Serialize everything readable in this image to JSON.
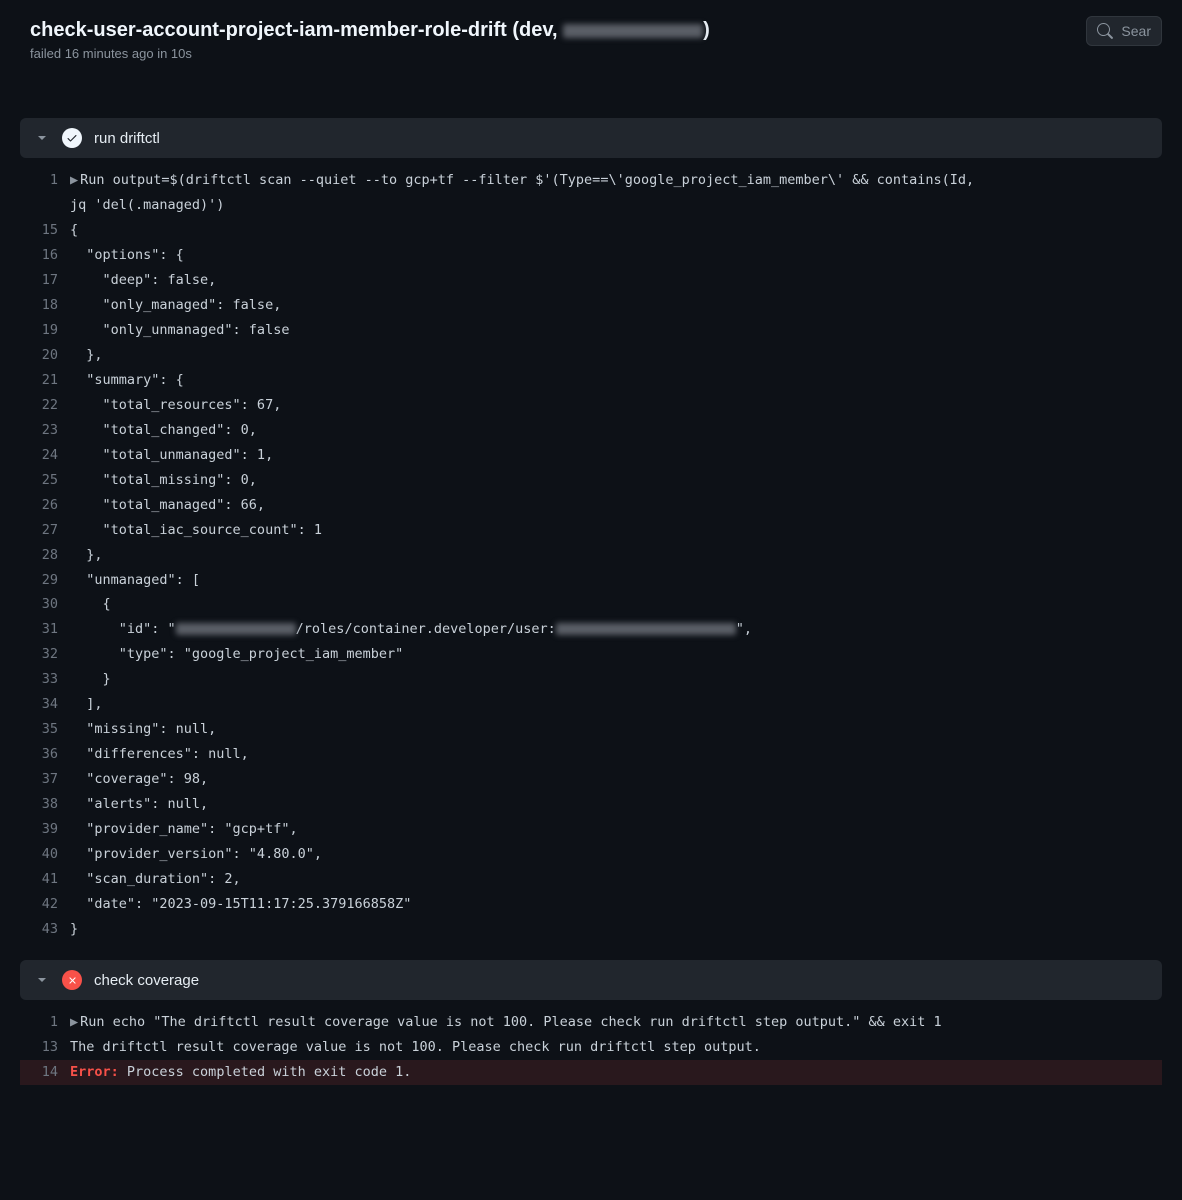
{
  "header": {
    "title_prefix": "check-user-account-project-iam-member-role-drift (dev, ",
    "title_suffix": ")",
    "subtitle": "failed 16 minutes ago in 10s",
    "search_placeholder": "Sear"
  },
  "partial_step": {
    "label": "..."
  },
  "step_run": {
    "title": "run driftctl",
    "lines": [
      {
        "no": "1",
        "tri": true,
        "text": "Run output=$(driftctl scan --quiet --to gcp+tf --filter $'(Type==\\'google_project_iam_member\\' && contains(Id,"
      },
      {
        "no": "",
        "text": "jq 'del(.managed)')"
      },
      {
        "no": "15",
        "text": "{"
      },
      {
        "no": "16",
        "text": "  \"options\": {"
      },
      {
        "no": "17",
        "text": "    \"deep\": false,"
      },
      {
        "no": "18",
        "text": "    \"only_managed\": false,"
      },
      {
        "no": "19",
        "text": "    \"only_unmanaged\": false"
      },
      {
        "no": "20",
        "text": "  },"
      },
      {
        "no": "21",
        "text": "  \"summary\": {"
      },
      {
        "no": "22",
        "text": "    \"total_resources\": 67,"
      },
      {
        "no": "23",
        "text": "    \"total_changed\": 0,"
      },
      {
        "no": "24",
        "text": "    \"total_unmanaged\": 1,"
      },
      {
        "no": "25",
        "text": "    \"total_missing\": 0,"
      },
      {
        "no": "26",
        "text": "    \"total_managed\": 66,"
      },
      {
        "no": "27",
        "text": "    \"total_iac_source_count\": 1"
      },
      {
        "no": "28",
        "text": "  },"
      },
      {
        "no": "29",
        "text": "  \"unmanaged\": ["
      },
      {
        "no": "30",
        "text": "    {"
      },
      {
        "no": "31",
        "redact": true,
        "pre": "      \"id\": \"",
        "mid": "/roles/container.developer/user:",
        "post": "\","
      },
      {
        "no": "32",
        "text": "      \"type\": \"google_project_iam_member\""
      },
      {
        "no": "33",
        "text": "    }"
      },
      {
        "no": "34",
        "text": "  ],"
      },
      {
        "no": "35",
        "text": "  \"missing\": null,"
      },
      {
        "no": "36",
        "text": "  \"differences\": null,"
      },
      {
        "no": "37",
        "text": "  \"coverage\": 98,"
      },
      {
        "no": "38",
        "text": "  \"alerts\": null,"
      },
      {
        "no": "39",
        "text": "  \"provider_name\": \"gcp+tf\","
      },
      {
        "no": "40",
        "text": "  \"provider_version\": \"4.80.0\","
      },
      {
        "no": "41",
        "text": "  \"scan_duration\": 2,"
      },
      {
        "no": "42",
        "text": "  \"date\": \"2023-09-15T11:17:25.379166858Z\""
      },
      {
        "no": "43",
        "text": "}"
      }
    ]
  },
  "step_check": {
    "title": "check coverage",
    "lines": [
      {
        "no": "1",
        "tri": true,
        "text": "Run echo \"The driftctl result coverage value is not 100. Please check run driftctl step output.\" && exit 1"
      },
      {
        "no": "13",
        "text": "The driftctl result coverage value is not 100. Please check run driftctl step output."
      },
      {
        "no": "14",
        "err": true,
        "err_label": "Error:",
        "text": " Process completed with exit code 1."
      }
    ]
  }
}
